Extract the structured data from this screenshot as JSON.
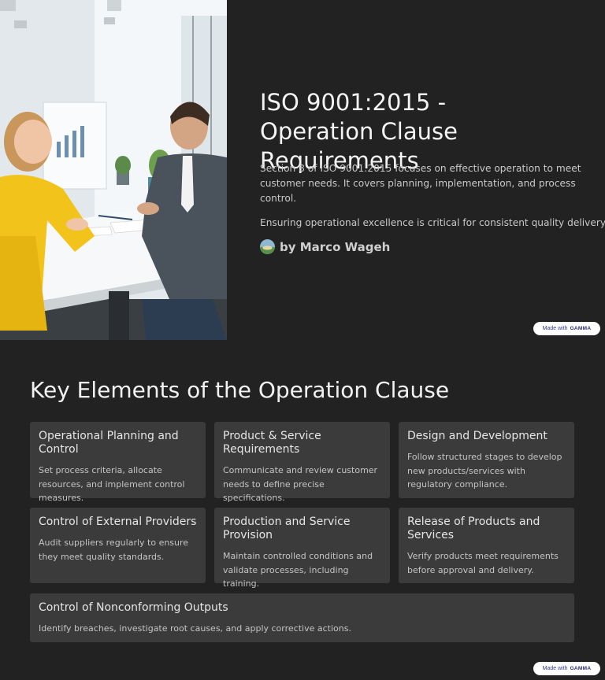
{
  "slide1": {
    "title": "ISO 9001:2015 - Operation Clause Requirements",
    "description": "Section 8 of ISO 9001:2015 focuses on effective operation to meet customer needs. It covers planning, implementation, and process control.",
    "emphasis": "Ensuring operational excellence is critical for consistent quality delivery.",
    "author": "by Marco Wageh"
  },
  "badge": {
    "prefix": "Made with",
    "brand": "GAMMA"
  },
  "slide2": {
    "heading": "Key Elements of the Operation Clause",
    "cards": [
      {
        "title": "Operational Planning and Control",
        "text": "Set process criteria, allocate resources, and implement control measures."
      },
      {
        "title": "Product & Service Requirements",
        "text": "Communicate and review customer needs to define precise specifications."
      },
      {
        "title": "Design and Development",
        "text": "Follow structured stages to develop new products/services with regulatory compliance."
      },
      {
        "title": "Control of External Providers",
        "text": "Audit suppliers regularly to ensure they meet quality standards."
      },
      {
        "title": "Production and Service Provision",
        "text": "Maintain controlled conditions and validate processes, including training."
      },
      {
        "title": "Release of Products and Services",
        "text": "Verify products meet requirements before approval and delivery."
      },
      {
        "title": "Control of Nonconforming Outputs",
        "text": "Identify breaches, investigate root causes, and apply corrective actions."
      }
    ]
  },
  "colors": {
    "background": "#222222",
    "card": "#3b3b3b",
    "badge_text": "#333a9a"
  }
}
